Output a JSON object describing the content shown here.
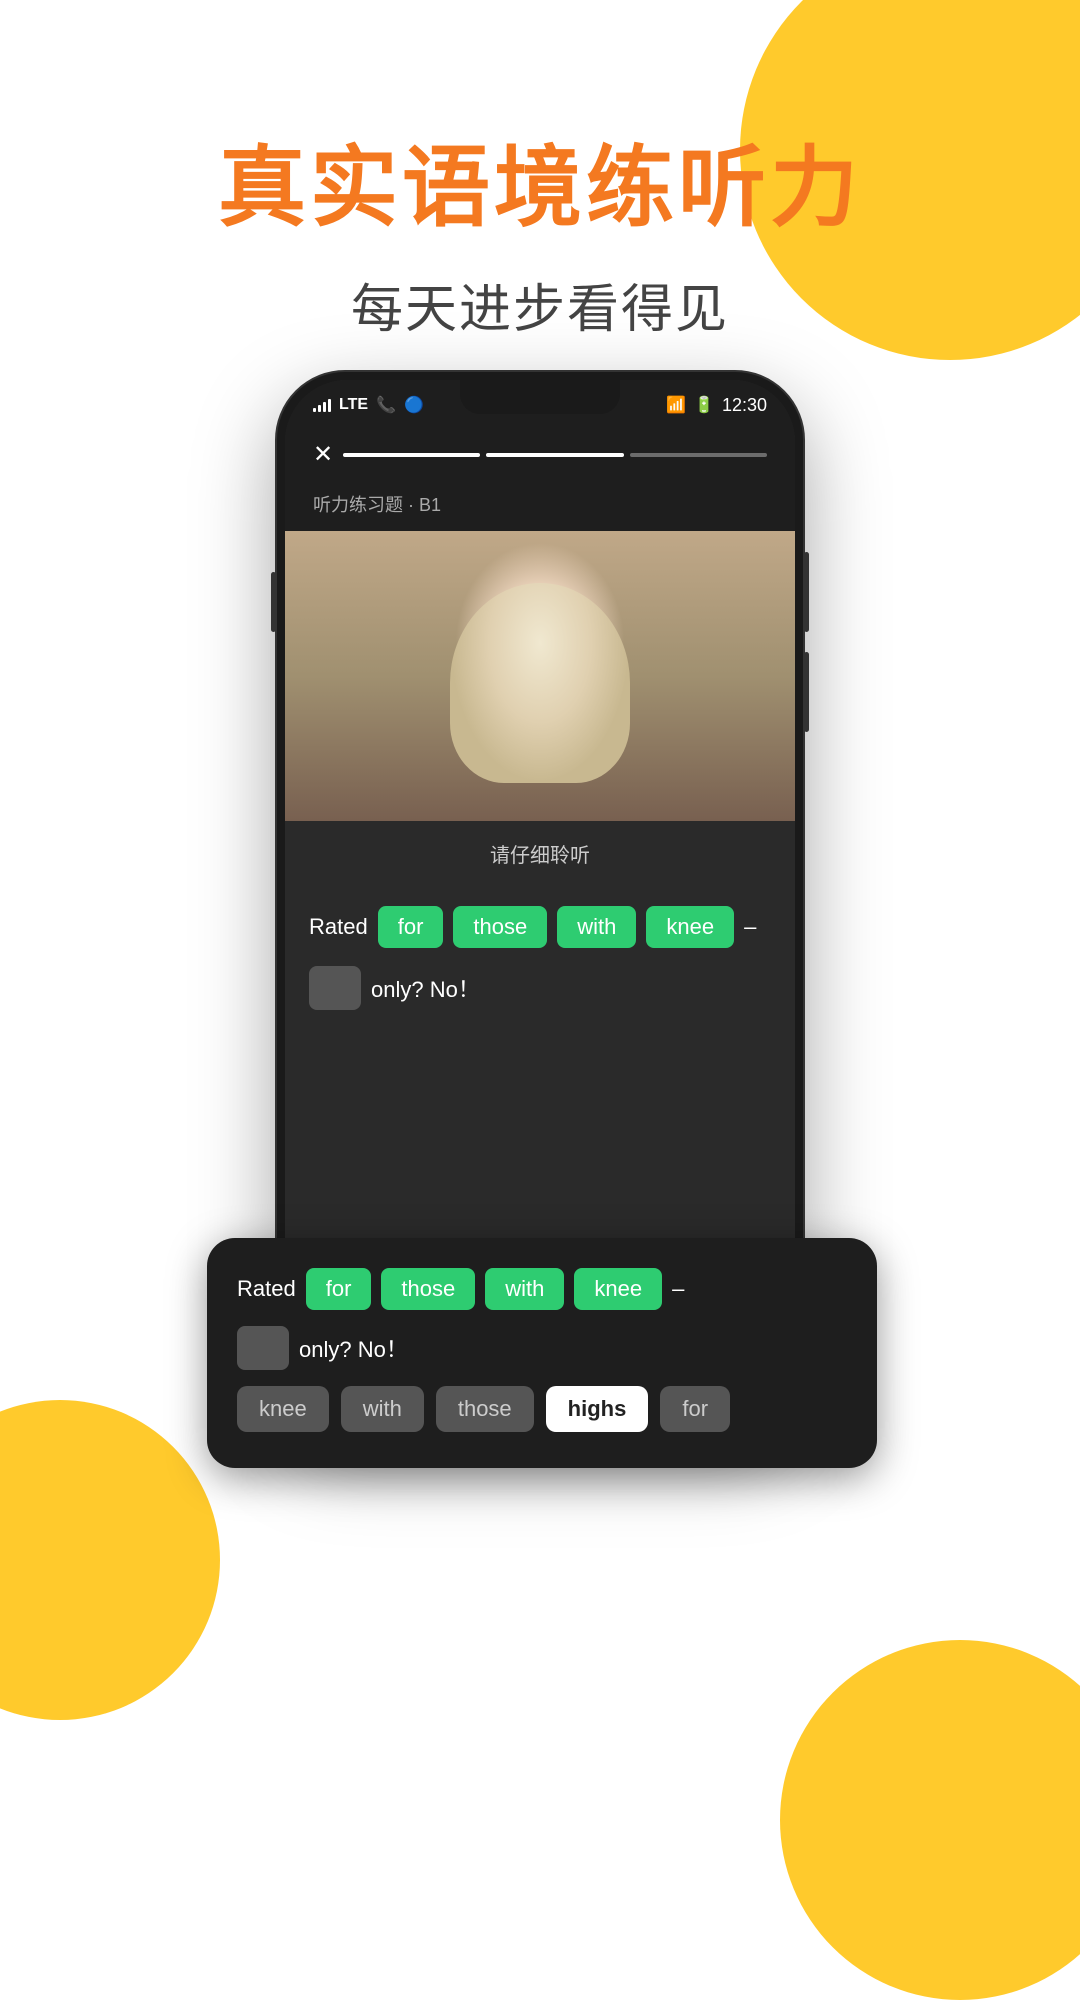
{
  "decorative": {
    "circle_color": "#FFC107"
  },
  "header": {
    "main_title": "真实语境练听力",
    "sub_title": "每天进步看得见"
  },
  "phone": {
    "status_bar": {
      "signal": "LTE",
      "time": "12:30",
      "wifi": true,
      "battery": true
    },
    "progress": {
      "close_icon": "✕",
      "segments": [
        {
          "active": true
        },
        {
          "active": true
        },
        {
          "active": false
        }
      ]
    },
    "exercise_label": "听力练习题 · B1",
    "listen_label": "请仔细聆听",
    "sentence": {
      "rated": "Rated",
      "words": [
        "for",
        "those",
        "with",
        "knee"
      ],
      "dash": "–",
      "placeholder": "",
      "suffix": "only?  No！"
    },
    "choices": [
      {
        "word": "knee",
        "selected": false
      },
      {
        "word": "with",
        "selected": false
      },
      {
        "word": "those",
        "selected": false
      },
      {
        "word": "highs",
        "selected": true
      },
      {
        "word": "for",
        "selected": false
      }
    ]
  }
}
